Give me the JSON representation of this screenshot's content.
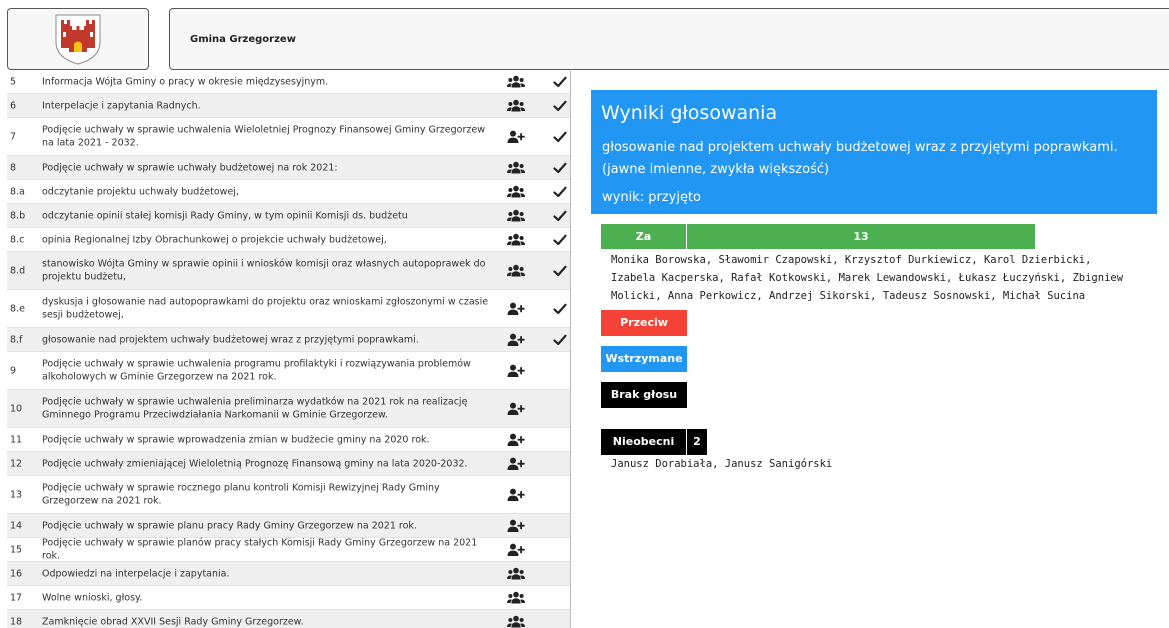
{
  "header": {
    "title": "Gmina Grzegorzew",
    "logo": "coat-of-arms"
  },
  "agenda": {
    "items": [
      {
        "num": "5",
        "text": "Informacja Wójta Gminy o pracy w okresie międzysesyjnym.",
        "icon": "users-icon",
        "done": true
      },
      {
        "num": "6",
        "text": "Interpelacje i zapytania Radnych.",
        "icon": "users-icon",
        "done": true
      },
      {
        "num": "7",
        "text": "Podjęcie uchwały w sprawie uchwalenia Wieloletniej Prognozy Finansowej Gminy Grzegorzew na lata 2021 - 2032.",
        "icon": "user-plus-icon",
        "done": true
      },
      {
        "num": "8",
        "text": "Podjęcie uchwały w sprawie uchwały budżetowej na rok 2021:",
        "icon": "users-icon",
        "done": true
      },
      {
        "num": "8.a",
        "text": "odczytanie projektu uchwały budżetowej,",
        "icon": "users-icon",
        "done": true
      },
      {
        "num": "8.b",
        "text": "odczytanie opinii stałej komisji Rady Gminy, w tym opinii Komisji ds. budżetu",
        "icon": "users-icon",
        "done": true
      },
      {
        "num": "8.c",
        "text": "opinia Regionalnej Izby Obrachunkowej o projekcie uchwały budżetowej,",
        "icon": "users-icon",
        "done": true
      },
      {
        "num": "8.d",
        "text": "stanowisko Wójta Gminy w sprawie opinii i wniosków komisji oraz własnych autopoprawek do projektu budżetu,",
        "icon": "users-icon",
        "done": true
      },
      {
        "num": "8.e",
        "text": "dyskusja i głosowanie nad autopoprawkami do projektu oraz wnioskami zgłoszonymi w czasie sesji budżetowej,",
        "icon": "user-plus-icon",
        "done": true
      },
      {
        "num": "8.f",
        "text": "głosowanie nad projektem uchwały budżetowej wraz z przyjętymi poprawkami.",
        "icon": "user-plus-icon",
        "done": true
      },
      {
        "num": "9",
        "text": "Podjęcie uchwały w sprawie uchwalenia programu profilaktyki i rozwiązywania problemów alkoholowych w Gminie Grzegorzew na 2021 rok.",
        "icon": "user-plus-icon",
        "done": false
      },
      {
        "num": "10",
        "text": "Podjęcie uchwały w sprawie uchwalenia preliminarza wydatków na 2021 rok na realizację Gminnego Programu Przeciwdziałania Narkomanii w Gminie Grzegorzew.",
        "icon": "user-plus-icon",
        "done": false
      },
      {
        "num": "11",
        "text": "Podjęcie uchwały w sprawie wprowadzenia zmian w budżecie gminy na 2020 rok.",
        "icon": "user-plus-icon",
        "done": false
      },
      {
        "num": "12",
        "text": "Podjęcie uchwały zmieniającej Wieloletnią Prognozę Finansową gminy na lata 2020-2032.",
        "icon": "user-plus-icon",
        "done": false
      },
      {
        "num": "13",
        "text": "Podjęcie uchwały w sprawie rocznego planu kontroli Komisji Rewizyjnej Rady Gminy Grzegorzew na 2021 rok.",
        "icon": "user-plus-icon",
        "done": false
      },
      {
        "num": "14",
        "text": "Podjęcie uchwały w sprawie planu pracy Rady Gminy Grzegorzew na 2021 rok.",
        "icon": "user-plus-icon",
        "done": false
      },
      {
        "num": "15",
        "text": "Podjęcie uchwały w sprawie planów pracy stałych Komisji Rady Gminy Grzegorzew na 2021 rok.",
        "icon": "user-plus-icon",
        "done": false
      },
      {
        "num": "16",
        "text": "Odpowiedzi na interpelacje i zapytania.",
        "icon": "users-icon",
        "done": false
      },
      {
        "num": "17",
        "text": "Wolne wnioski, głosy.",
        "icon": "users-icon",
        "done": false
      },
      {
        "num": "18",
        "text": "Zamknięcie obrad XXVII Sesji Rady Gminy Grzegorzew.",
        "icon": "users-icon",
        "done": false
      }
    ]
  },
  "results": {
    "heading": "Wyniki głosowania",
    "subject": "głosowanie nad projektem uchwały budżetowej wraz z przyjętymi poprawkami.",
    "mode": "(jawne imienne, zwykła większość)",
    "outcome": "wynik: przyjęto",
    "for_label": "Za",
    "for_count": "13",
    "for_names": "Monika Borowska, Sławomir Czapowski, Krzysztof Durkiewicz, Karol Dzierbicki, Izabela Kacperska, Rafał Kotkowski, Marek Lewandowski, Łukasz Łuczyński, Zbigniew Molicki, Anna Perkowicz, Andrzej Sikorski, Tadeusz Sosnowski, Michał Sucina",
    "against_label": "Przeciw",
    "abstain_label": "Wstrzymane",
    "novote_label": "Brak głosu",
    "absent_label": "Nieobecni",
    "absent_count": "2",
    "absent_names": "Janusz Dorabiała, Janusz Sanigórski",
    "colors": {
      "panel": "#2196f3",
      "for": "#4caf50",
      "against": "#f44336",
      "abstain": "#2196f3",
      "novote": "#000000"
    }
  }
}
